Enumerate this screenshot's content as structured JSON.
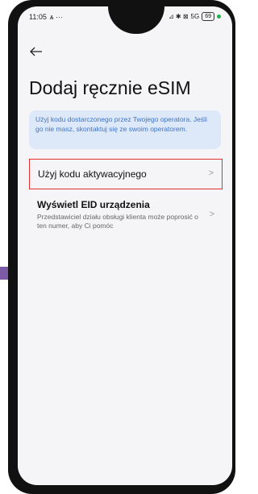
{
  "status_bar": {
    "time": "11:05",
    "left_icons": "ѧ ···",
    "right_icons": "⊿ ✱ ⊠",
    "network": "5G",
    "battery": "69"
  },
  "header": {
    "back_icon": "arrow-left-icon",
    "title": "Dodaj ręcznie eSIM"
  },
  "info_box": {
    "text": "Użyj kodu dostarczonego przez Twojego operatora. Jeśli go nie masz, skontaktuj się ze swoim operatorem.",
    "color": "#3e74c9",
    "background": "#dde9f8"
  },
  "options": [
    {
      "title": "Użyj kodu aktywacyjnego",
      "highlight_color": "#e0312e"
    },
    {
      "title": "Wyświetl EID urządzenia",
      "description": "Przedstawiciel działu obsługi klienta może poprosić o ten numer, aby Ci pomóc"
    }
  ],
  "colors": {
    "screen_bg": "#f5f5f7",
    "frame": "#111111",
    "status_dot": "#1fb24a"
  }
}
